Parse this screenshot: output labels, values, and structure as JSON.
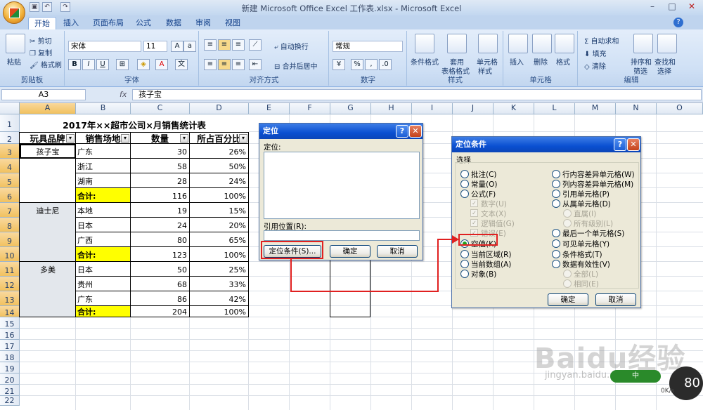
{
  "window": {
    "title": "新建 Microsoft Office Excel 工作表.xlsx - Microsoft Excel"
  },
  "tabs": [
    "开始",
    "插入",
    "页面布局",
    "公式",
    "数据",
    "审阅",
    "视图"
  ],
  "ribbon": {
    "clipboard": {
      "label": "剪贴板",
      "paste": "粘贴",
      "cut": "剪切",
      "copy": "复制",
      "format_painter": "格式刷"
    },
    "font": {
      "label": "字体",
      "font_name": "宋体",
      "font_size": "11",
      "bold": "B",
      "italic": "I",
      "underline": "U"
    },
    "alignment": {
      "label": "对齐方式",
      "wrap": "自动换行",
      "merge": "合并后居中"
    },
    "number": {
      "label": "数字",
      "format": "常规",
      "percent": "%"
    },
    "styles": {
      "label": "样式",
      "conditional": "条件格式",
      "as_table_1": "套用",
      "as_table_2": "表格格式",
      "cell_style_1": "单元格",
      "cell_style_2": "样式"
    },
    "cells": {
      "label": "单元格",
      "insert": "插入",
      "delete": "删除",
      "format": "格式"
    },
    "editing": {
      "label": "编辑",
      "autosum": "自动求和",
      "fill": "填充",
      "clear": "清除",
      "sort_1": "排序和",
      "sort_2": "筛选",
      "find_1": "查找和",
      "find_2": "选择"
    }
  },
  "formula_bar": {
    "name_box": "A3",
    "fx": "fx",
    "content": "孩子宝"
  },
  "columns": [
    "A",
    "B",
    "C",
    "D",
    "E",
    "F",
    "G",
    "H",
    "I",
    "J",
    "K",
    "L",
    "M",
    "N",
    "O"
  ],
  "rows": [
    "1",
    "2",
    "3",
    "4",
    "5",
    "6",
    "7",
    "8",
    "9",
    "10",
    "11",
    "12",
    "13",
    "14",
    "15",
    "16",
    "17",
    "18",
    "19",
    "20",
    "21",
    "22"
  ],
  "sheet": {
    "title": "2017年××超市公司×月销售统计表",
    "headers": [
      "玩具品牌",
      "销售场地",
      "数量",
      "所占百分比"
    ],
    "brands": [
      "孩子宝",
      "迪士尼",
      "多美"
    ],
    "locations": [
      "广东",
      "浙江",
      "湖南",
      "合计:",
      "本地",
      "日本",
      "广西",
      "合计:",
      "日本",
      "贵州",
      "广东",
      "合计:"
    ],
    "quantities": [
      "30",
      "58",
      "28",
      "116",
      "19",
      "24",
      "80",
      "123",
      "50",
      "68",
      "86",
      "204"
    ],
    "percents": [
      "26%",
      "50%",
      "24%",
      "100%",
      "15%",
      "20%",
      "65%",
      "100%",
      "25%",
      "33%",
      "42%",
      "100%"
    ]
  },
  "goto_dialog": {
    "title": "定位",
    "goto_label": "定位:",
    "reference_label": "引用位置(R):",
    "special_btn": "定位条件(S)...",
    "ok": "确定",
    "cancel": "取消"
  },
  "special_dialog": {
    "title": "定位条件",
    "section": "选择",
    "left_options": [
      "批注(C)",
      "常量(O)",
      "公式(F)",
      "数字(U)",
      "文本(X)",
      "逻辑值(G)",
      "错误(E)",
      "空值(K)",
      "当前区域(R)",
      "当前数组(A)",
      "对象(B)"
    ],
    "right_options": [
      "行内容差异单元格(W)",
      "列内容差异单元格(M)",
      "引用单元格(P)",
      "从属单元格(D)",
      "直属(I)",
      "所有级别(L)",
      "最后一个单元格(S)",
      "可见单元格(Y)",
      "条件格式(T)",
      "数据有效性(V)",
      "全部(L)",
      "相同(E)"
    ],
    "ok": "确定",
    "cancel": "取消",
    "selected": "空值(K)"
  },
  "watermark": {
    "main": "Baidu经验",
    "sub": "jingyan.baidu.com",
    "badge": "中",
    "speed": "80",
    "speed_unit": "0K/s"
  }
}
